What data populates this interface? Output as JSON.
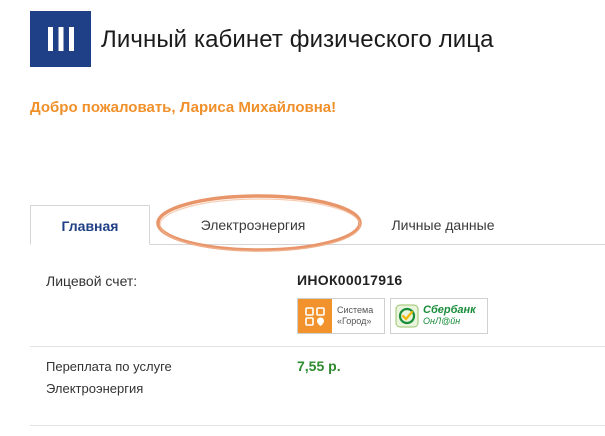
{
  "header": {
    "title": "Личный кабинет физического лица",
    "logo_icon": "three-bars-logo-icon",
    "logo_color": "#1f3f86"
  },
  "welcome": {
    "text": "Добро пожаловать, Лариса Михайловна!",
    "color": "#f0902a"
  },
  "tabs": [
    {
      "label": "Главная",
      "active": true
    },
    {
      "label": "Электроэнергия",
      "active": false,
      "highlighted": true
    },
    {
      "label": "Личные данные",
      "active": false
    }
  ],
  "highlight_color": "#e8956a",
  "account": {
    "label": "Лицевой счет:",
    "number": "ИНОК00017916"
  },
  "payment_methods": {
    "gorod": {
      "line1": "Система",
      "line2": "«Город»",
      "icon": "gorod-icon",
      "color": "#f2922d"
    },
    "sberbank": {
      "name": "Сбербанк",
      "sub": "ОнЛ@йн",
      "icon": "sberbank-icon",
      "color": "#1a8d3a"
    }
  },
  "overpayment": {
    "label_line1": "Переплата по услуге",
    "label_line2": "Электроэнергия",
    "value": "7,55 р.",
    "color": "#2e8b2e"
  }
}
